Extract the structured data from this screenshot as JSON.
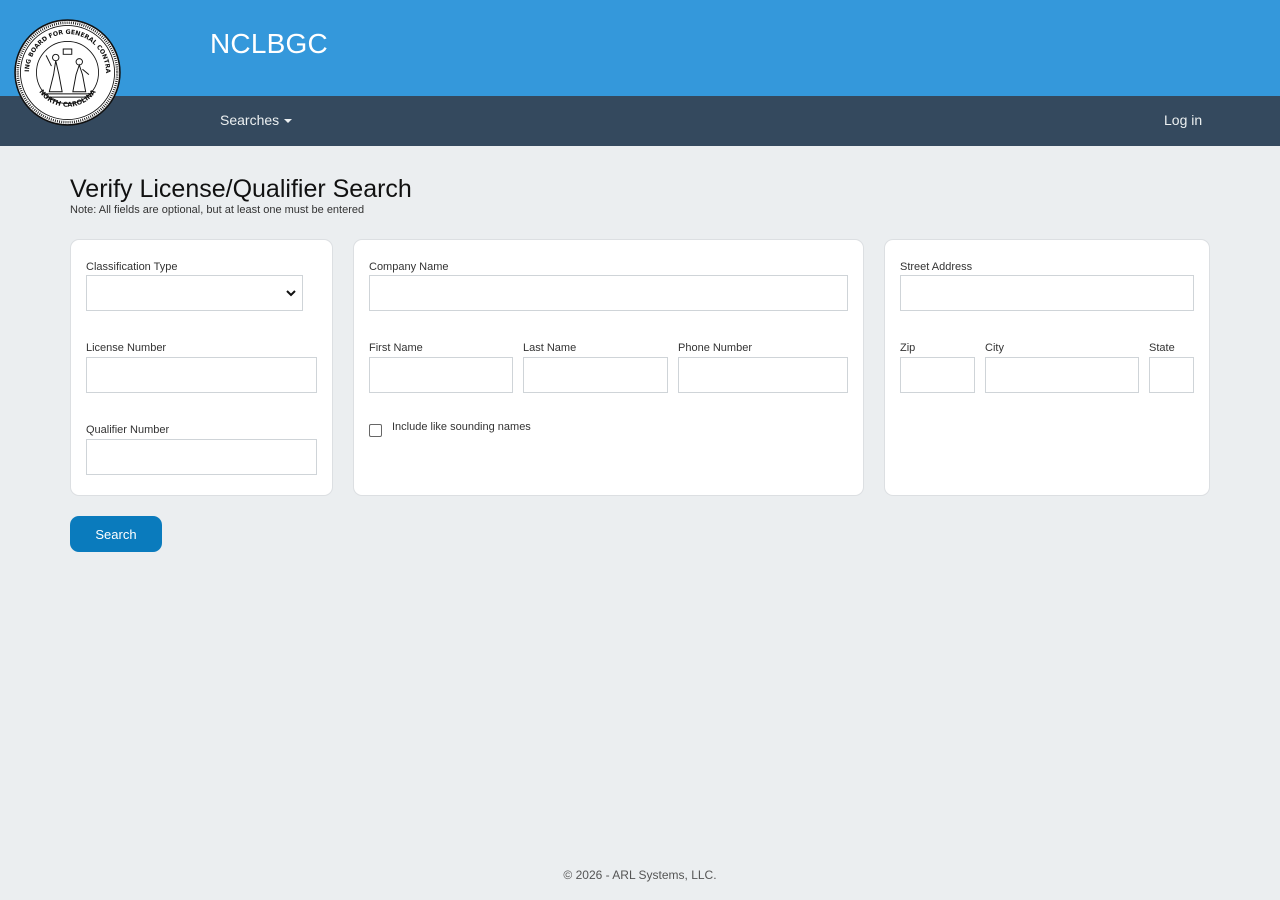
{
  "header": {
    "brand": "NCLBGC",
    "seal_text_top": "LICENSING BOARD FOR GENERAL CONTRACTORS",
    "seal_text_bottom": "NORTH CAROLINA"
  },
  "nav": {
    "searches_label": "Searches",
    "login_label": "Log in"
  },
  "page": {
    "title": "Verify License/Qualifier Search",
    "note": "Note: All fields are optional, but at least one must be entered"
  },
  "form": {
    "classification_type": {
      "label": "Classification Type",
      "value": ""
    },
    "license_number": {
      "label": "License Number",
      "value": ""
    },
    "qualifier_number": {
      "label": "Qualifier Number",
      "value": ""
    },
    "company_name": {
      "label": "Company Name",
      "value": ""
    },
    "first_name": {
      "label": "First Name",
      "value": ""
    },
    "last_name": {
      "label": "Last Name",
      "value": ""
    },
    "phone_number": {
      "label": "Phone Number",
      "value": ""
    },
    "like_sounding": {
      "label": "Include like sounding names",
      "checked": false
    },
    "street_address": {
      "label": "Street Address",
      "value": ""
    },
    "zip": {
      "label": "Zip",
      "value": ""
    },
    "city": {
      "label": "City",
      "value": ""
    },
    "state": {
      "label": "State",
      "value": ""
    },
    "search_button": "Search"
  },
  "footer": {
    "text": "© 2026 - ARL Systems, LLC."
  },
  "colors": {
    "header_bg": "#3498db",
    "navbar_bg": "#34495e",
    "page_bg": "#ebeef0",
    "button_bg": "#0a7bbd"
  },
  "icons": {
    "seal": "state-board-seal-icon",
    "dropdown": "chevron-down-icon",
    "nav_caret": "caret-down-icon"
  }
}
